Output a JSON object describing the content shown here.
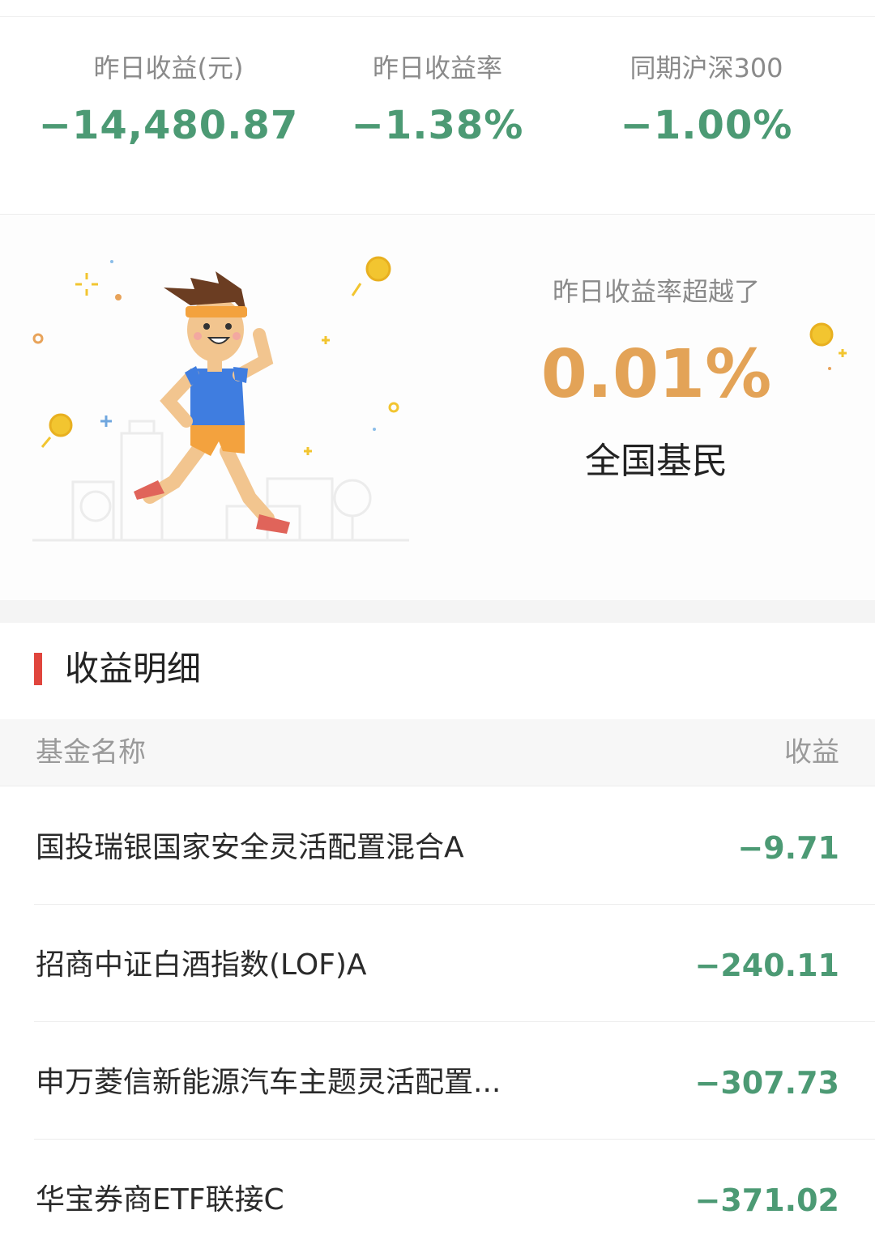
{
  "stats": [
    {
      "label": "昨日收益(元)",
      "value": "−14,480.87"
    },
    {
      "label": "昨日收益率",
      "value": "−1.38%"
    },
    {
      "label": "同期沪深300",
      "value": "−1.00%"
    }
  ],
  "banner": {
    "beat_label": "昨日收益率超越了",
    "beat_percent": "0.01%",
    "beat_who": "全国基民"
  },
  "section": {
    "title": "收益明细"
  },
  "table": {
    "header_name": "基金名称",
    "header_income": "收益",
    "rows": [
      {
        "name": "国投瑞银国家安全灵活配置混合A",
        "income": "−9.71"
      },
      {
        "name": "招商中证白酒指数(LOF)A",
        "income": "−240.11"
      },
      {
        "name": "申万菱信新能源汽车主题灵活配置...",
        "income": "−307.73"
      },
      {
        "name": "华宝券商ETF联接C",
        "income": "−371.02"
      }
    ]
  },
  "colors": {
    "loss_green": "#4c9a74",
    "accent_orange": "#e3a357",
    "section_marker_red": "#e0453d"
  }
}
